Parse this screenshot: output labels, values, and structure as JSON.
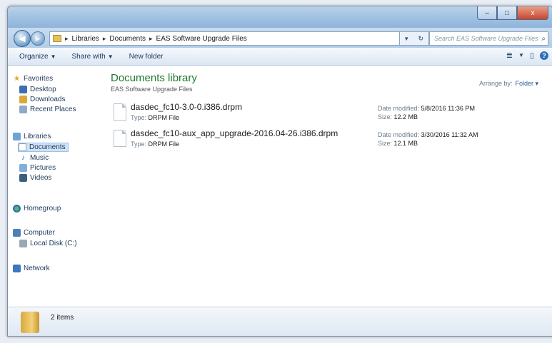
{
  "window": {
    "caption_buttons": {
      "minimize": "–",
      "maximize": "□",
      "close": "x"
    }
  },
  "address": {
    "back_icon": "◀",
    "forward_icon": "▶",
    "crumbs": [
      "Libraries",
      "Documents",
      "EAS Software Upgrade Files"
    ],
    "dropdown": "▾",
    "refresh": "↻",
    "search_placeholder": "Search EAS Software Upgrade Files"
  },
  "toolbar": {
    "organize": "Organize",
    "share_with": "Share with",
    "new_folder": "New folder",
    "view_icon": "≣",
    "preview_icon": "▯",
    "help_icon": "?"
  },
  "nav": {
    "favorites": {
      "label": "Favorites",
      "items": [
        "Desktop",
        "Downloads",
        "Recent Places"
      ]
    },
    "libraries": {
      "label": "Libraries",
      "items": [
        "Documents",
        "Music",
        "Pictures",
        "Videos"
      ]
    },
    "homegroup": "Homegroup",
    "computer": {
      "label": "Computer",
      "items": [
        "Local Disk (C:)"
      ]
    },
    "network": "Network"
  },
  "content": {
    "library_title": "Documents library",
    "library_subtitle": "EAS Software Upgrade Files",
    "arrange_label": "Arrange by:",
    "arrange_value": "Folder ▾",
    "files": [
      {
        "name": "dasdec_fc10-3.0-0.i386.drpm",
        "type_label": "Type:",
        "type": "DRPM File",
        "date_label": "Date modified:",
        "date": "5/8/2016 11:36 PM",
        "size_label": "Size:",
        "size": "12.2 MB"
      },
      {
        "name": "dasdec_fc10-aux_app_upgrade-2016.04-26.i386.drpm",
        "type_label": "Type:",
        "type": "DRPM File",
        "date_label": "Date modified:",
        "date": "3/30/2016 11:32 AM",
        "size_label": "Size:",
        "size": "12.1 MB"
      }
    ]
  },
  "details": {
    "item_count": "2 items"
  },
  "colors": {
    "library_title": "#1e7a2e",
    "selection": "#cfe3f7",
    "accent": "#2f5fa0"
  }
}
